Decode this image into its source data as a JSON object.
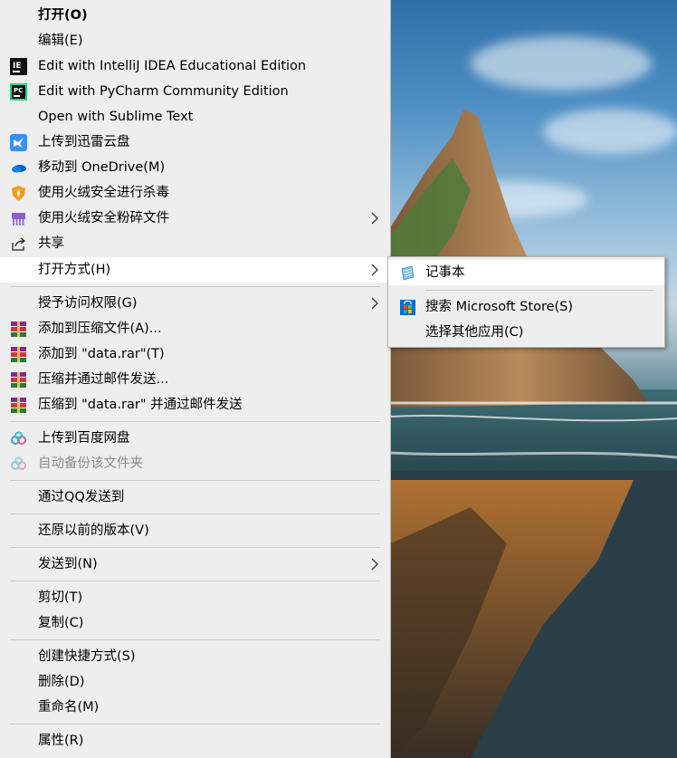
{
  "context_menu": {
    "items": [
      {
        "label": "打开(O)",
        "icon": "none"
      },
      {
        "label": "编辑(E)",
        "icon": "none"
      },
      {
        "label": "Edit with IntelliJ IDEA Educational Edition",
        "icon": "intellij-icon"
      },
      {
        "label": "Edit with PyCharm Community Edition",
        "icon": "pycharm-icon"
      },
      {
        "label": "Open with Sublime Text",
        "icon": "none"
      },
      {
        "label": "上传到迅雷云盘",
        "icon": "thunder-cloud-icon"
      },
      {
        "label": "移动到 OneDrive(M)",
        "icon": "onedrive-icon"
      },
      {
        "label": "使用火绒安全进行杀毒",
        "icon": "huorong-shield-icon"
      },
      {
        "label": "使用火绒安全粉碎文件",
        "icon": "shredder-icon"
      },
      {
        "label": "共享",
        "icon": "share-icon"
      },
      {
        "label": "打开方式(H)",
        "icon": "none"
      },
      {
        "label": "授予访问权限(G)",
        "icon": "none"
      },
      {
        "label": "添加到压缩文件(A)...",
        "icon": "winrar-icon"
      },
      {
        "label": "添加到 \"data.rar\"(T)",
        "icon": "winrar-icon"
      },
      {
        "label": "压缩并通过邮件发送...",
        "icon": "winrar-icon"
      },
      {
        "label": "压缩到 \"data.rar\" 并通过邮件发送",
        "icon": "winrar-icon"
      },
      {
        "label": "上传到百度网盘",
        "icon": "baidu-netdisk-icon"
      },
      {
        "label": "自动备份该文件夹",
        "icon": "baidu-netdisk-icon"
      },
      {
        "label": "通过QQ发送到",
        "icon": "none"
      },
      {
        "label": "还原以前的版本(V)",
        "icon": "none"
      },
      {
        "label": "发送到(N)",
        "icon": "none"
      },
      {
        "label": "剪切(T)",
        "icon": "none"
      },
      {
        "label": "复制(C)",
        "icon": "none"
      },
      {
        "label": "创建快捷方式(S)",
        "icon": "none"
      },
      {
        "label": "删除(D)",
        "icon": "none"
      },
      {
        "label": "重命名(M)",
        "icon": "none"
      },
      {
        "label": "属性(R)",
        "icon": "none"
      }
    ]
  },
  "open_with_submenu": {
    "items": [
      {
        "label": "记事本",
        "icon": "notepad-icon"
      },
      {
        "label": "搜索 Microsoft Store(S)",
        "icon": "microsoft-store-icon"
      },
      {
        "label": "选择其他应用(C)",
        "icon": "none"
      }
    ]
  },
  "colors": {
    "menu_bg": "#eeeeee",
    "hover_bg": "#ffffff",
    "separator": "#c9c9c9",
    "disabled_text": "#8a8a8a"
  }
}
